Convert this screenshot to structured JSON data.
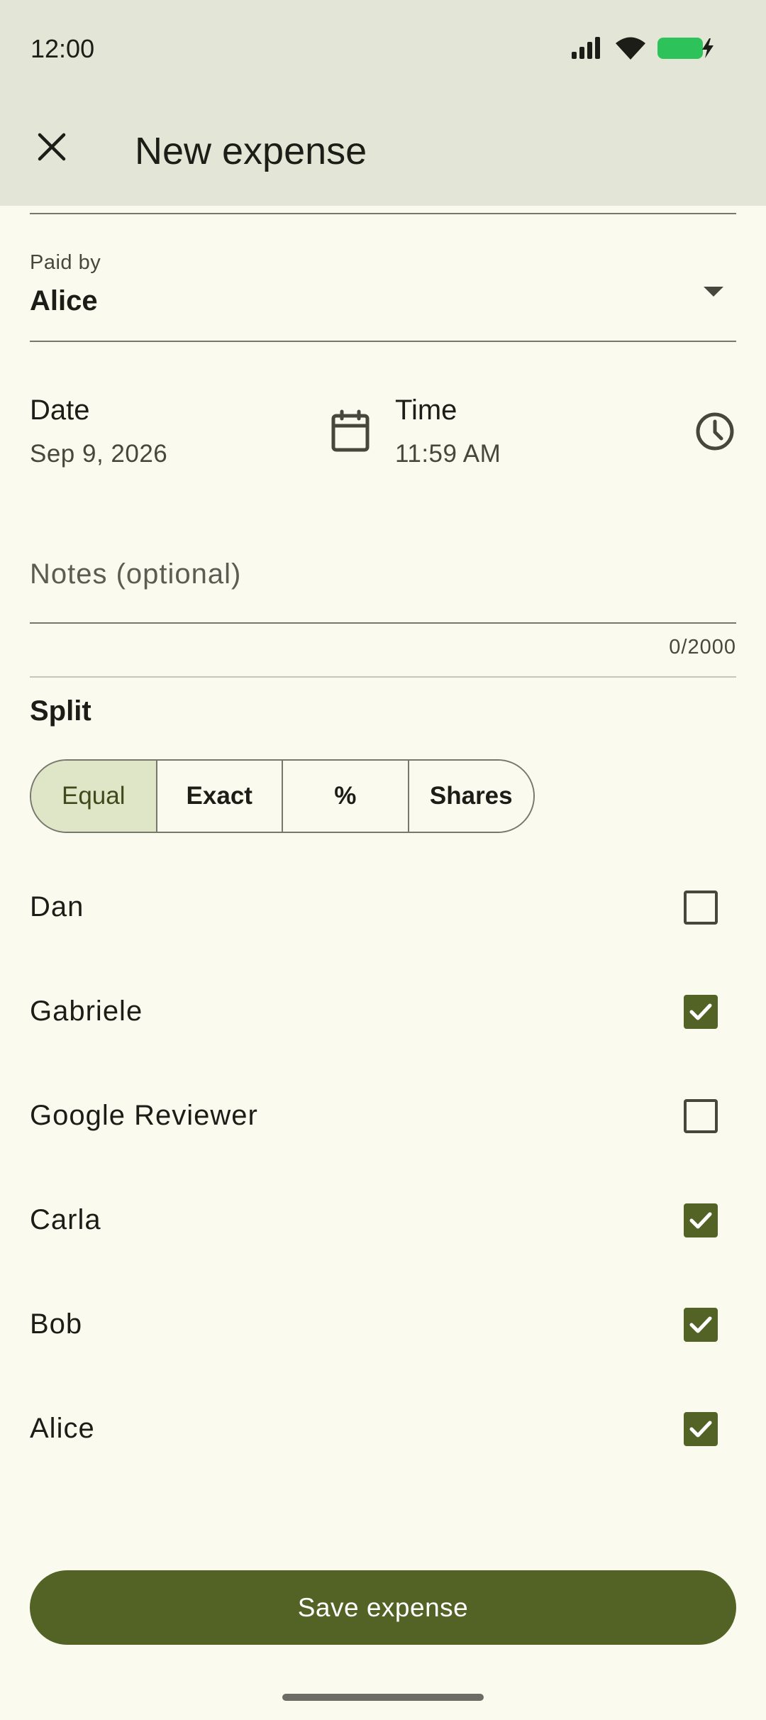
{
  "status_bar": {
    "time": "12:00",
    "icons": [
      "signal-icon",
      "wifi-icon",
      "battery-charging-icon"
    ],
    "battery_color": "#2ec35a"
  },
  "app_bar": {
    "title": "New expense",
    "close_icon": "close-icon",
    "background": "#e3e5d6"
  },
  "paid_by": {
    "label": "Paid by",
    "value": "Alice"
  },
  "date": {
    "label": "Date",
    "value": "Sep 9, 2026",
    "icon": "calendar-icon"
  },
  "time": {
    "label": "Time",
    "value": "11:59 AM",
    "icon": "clock-icon"
  },
  "notes": {
    "placeholder": "Notes (optional)",
    "value": "",
    "counter": "0/2000"
  },
  "split": {
    "title": "Split",
    "options": [
      {
        "label": "Equal",
        "selected": true
      },
      {
        "label": "Exact",
        "selected": false
      },
      {
        "label": "%",
        "selected": false
      },
      {
        "label": "Shares",
        "selected": false
      }
    ],
    "selected_color": "#dfe6c7"
  },
  "members": [
    {
      "name": "Dan",
      "checked": false
    },
    {
      "name": "Gabriele",
      "checked": true
    },
    {
      "name": "Google Reviewer",
      "checked": false
    },
    {
      "name": "Carla",
      "checked": true
    },
    {
      "name": "Bob",
      "checked": true
    },
    {
      "name": "Alice",
      "checked": true
    }
  ],
  "save_button": {
    "label": "Save expense",
    "color": "#536325"
  }
}
